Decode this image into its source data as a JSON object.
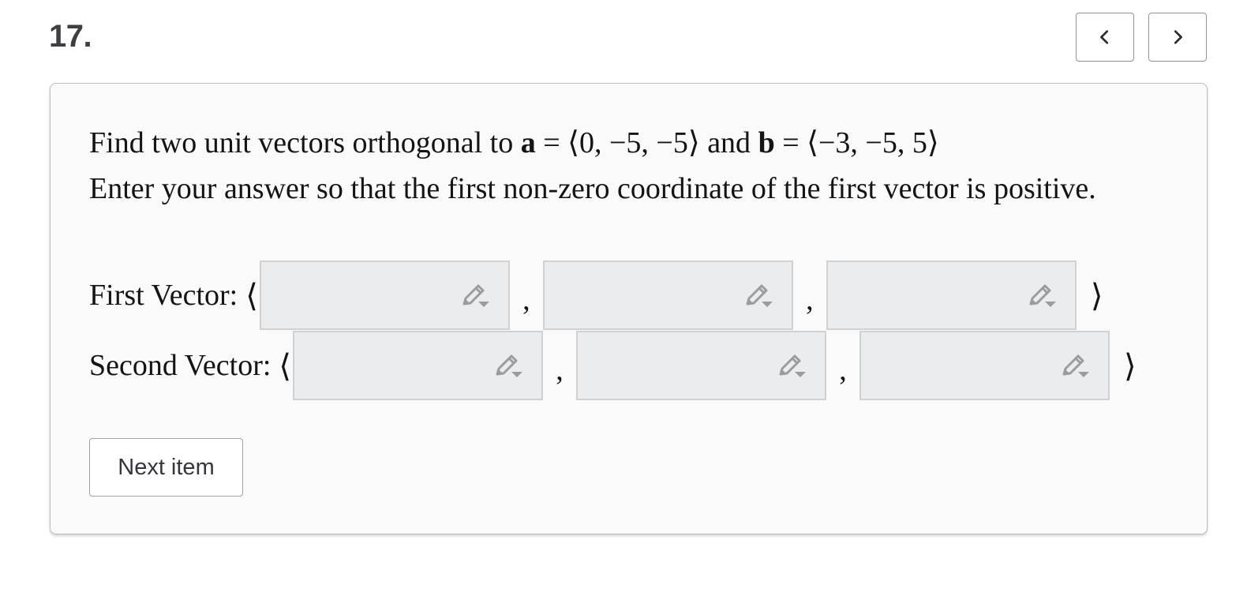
{
  "problem": {
    "number": "17."
  },
  "nav": {
    "prev_icon": "chevron-left-icon",
    "next_icon": "chevron-right-icon"
  },
  "question": {
    "intro": "Find two unit vectors orthogonal to ",
    "var_a": "a",
    "a_value": " = ⟨0, −5, −5⟩",
    "and_text": " and ",
    "var_b": "b",
    "b_value": " = ⟨−3, −5, 5⟩",
    "instruction": "Enter your answer so that the first non-zero coordinate of the first vector is positive."
  },
  "vectors": {
    "first_label": "First Vector:",
    "second_label": "Second Vector:",
    "open_bracket": "⟨",
    "close_bracket": "⟩",
    "separator": ",",
    "first_values": [
      "",
      "",
      ""
    ],
    "second_values": [
      "",
      "",
      ""
    ],
    "input_icon": "pencil-dropdown-icon"
  },
  "actions": {
    "next_item_label": "Next item"
  },
  "colors": {
    "input_bg": "#ebecee",
    "input_border": "#cfd1d4",
    "card_bg": "#fafafa",
    "icon_gray": "#9a9ca0"
  }
}
